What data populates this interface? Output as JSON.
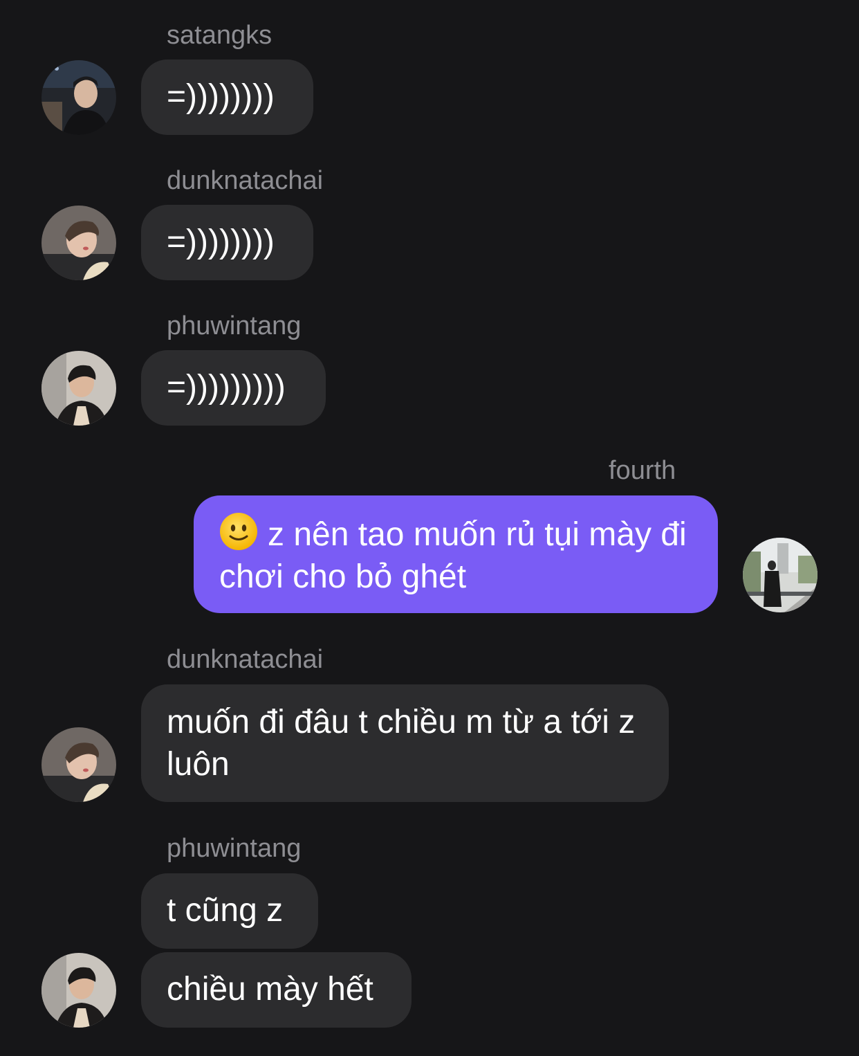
{
  "messages": [
    {
      "sender": "satangks",
      "text": "=))))))))"
    },
    {
      "sender": "dunknatachai",
      "text": "=))))))))"
    },
    {
      "sender": "phuwintang",
      "text": "=)))))))))"
    },
    {
      "sender": "fourth",
      "text": "z nên tao muốn rủ tụi mày đi chơi cho bỏ ghét",
      "emoji": "slightly-smiling-face-icon"
    },
    {
      "sender": "dunknatachai",
      "text": "muốn đi đâu t chiều m từ a tới z luôn"
    },
    {
      "sender": "phuwintang",
      "text": "t cũng z"
    },
    {
      "text": "chiều mày hết"
    }
  ],
  "colors": {
    "background": "#161618",
    "incoming_bubble": "#2c2c2e",
    "outgoing_bubble": "#7a5cf5",
    "sender_name": "#8e8e93"
  }
}
